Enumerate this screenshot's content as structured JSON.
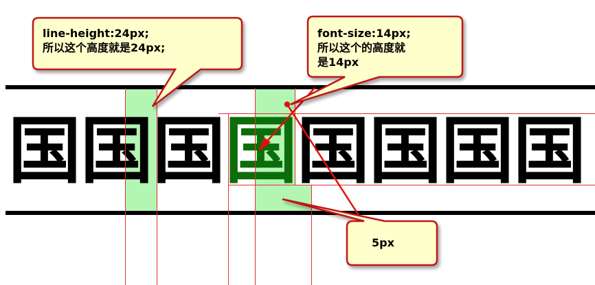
{
  "glyph": "国",
  "glyph_count": 8,
  "colors": {
    "highlight": "#b3f5b3",
    "highlight_glyph": "#0b6e0b",
    "guide_line": "#e23030",
    "callout_fill": "#ffffcc",
    "callout_border": "#c01818"
  },
  "callouts": {
    "line_height": {
      "line1": "line-height:24px;",
      "line2": "所以这个高度就是24px;"
    },
    "font_size": {
      "line1": "font-size:14px;",
      "line2": "所以这个的高度就",
      "line3": "是14px"
    },
    "gap": {
      "line1": "5px"
    }
  }
}
